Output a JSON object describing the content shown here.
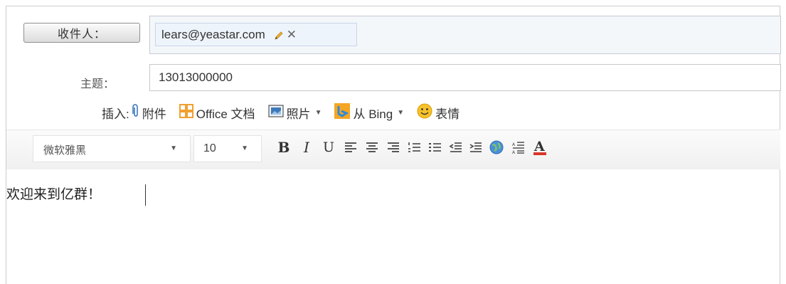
{
  "compose": {
    "to_button_label": "收件人：",
    "recipient_chip": "lears@yeastar.com",
    "subject_label": "主题：",
    "subject_value": "13013000000",
    "insert": {
      "label": "插入:",
      "attachment": "附件",
      "office_doc": "Office 文档",
      "photos": "照片",
      "bing": "从 Bing",
      "emoji": "表情"
    },
    "toolbar": {
      "font_family": "微软雅黑",
      "font_size": "10",
      "bold": "B",
      "italic": "I",
      "underline": "U"
    },
    "body_text": "欢迎来到亿群！"
  },
  "colors": {
    "office_orange": "#f0a030",
    "bing_orange": "#f5a623",
    "link_blue": "#2f6fb8",
    "font_color_red": "#d9362b"
  }
}
